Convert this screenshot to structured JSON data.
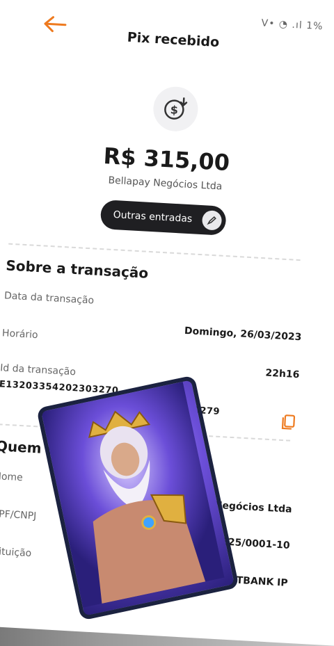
{
  "status_bar": {
    "text": "V• ◔ .ıl 1%"
  },
  "header": {
    "title": "Pix recebido",
    "back_icon": "arrow-left-icon"
  },
  "summary": {
    "amount": "R$ 315,00",
    "payer": "Bellapay Negócios Ltda",
    "chip_label": "Outras entradas"
  },
  "transaction": {
    "section_title": "Sobre a transação",
    "date_label": "Data da transação",
    "date_value": "Domingo, 26/03/2023",
    "time_label": "Horário",
    "time_value": "22h16",
    "id_label": "Id da transação",
    "id_start": "E13203354202303270",
    "id_end": "3830279"
  },
  "who": {
    "section_title": "Quem e",
    "name_label": "Nome",
    "name_value": "Negócios Ltda",
    "doc_label": "CPF/CNPJ",
    "doc_value": "625/0001-10",
    "institution_label": "stituição",
    "institution_value": "FITBANK IP"
  },
  "colors": {
    "accent": "#ee7a1f",
    "chip": "#1f1f22"
  }
}
